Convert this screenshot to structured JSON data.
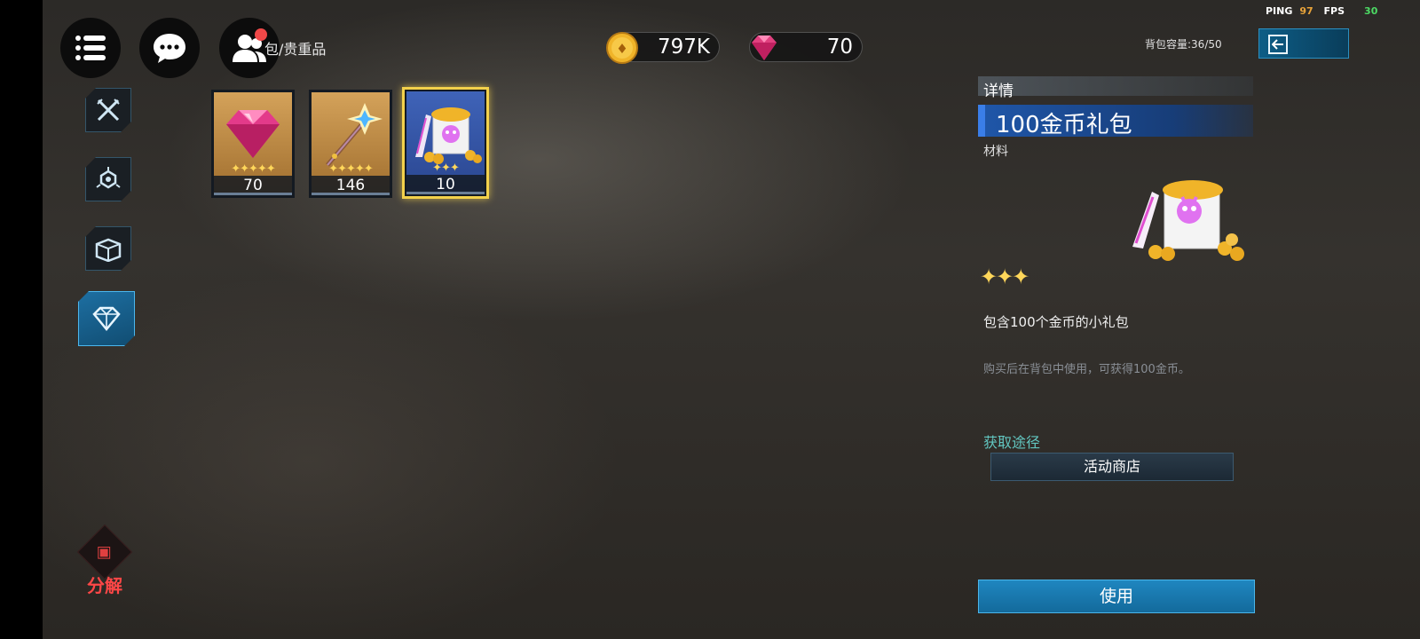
{
  "header": {
    "breadcrumb": "包/贵重品",
    "coins": "797K",
    "gems": "70",
    "capacity_label": "背包容量:36/50"
  },
  "perf": {
    "ping_label": "PING",
    "ping_value": "97",
    "fps_label": "FPS",
    "fps_value": "30"
  },
  "icons": {
    "menu": "menu-icon",
    "chat": "chat-icon",
    "friends": "friends-icon",
    "back": "arrow-left-icon",
    "coin": "coin-icon",
    "gem": "gem-icon",
    "categories": [
      "swords-icon",
      "module-icon",
      "box-icon",
      "diamond-icon"
    ]
  },
  "sidebar": {
    "active_category": 3,
    "decompose_label": "分解"
  },
  "inventory": {
    "items": [
      {
        "name": "gem",
        "stars": "✦✦✦✦✦",
        "count": "70",
        "frame": "gold"
      },
      {
        "name": "staff",
        "stars": "✦✦✦✦✦",
        "count": "146",
        "frame": "gold"
      },
      {
        "name": "coin-pack",
        "stars": "✦✦✦",
        "count": "10",
        "frame": "blue"
      }
    ],
    "selected_index": 2
  },
  "detail": {
    "header": "详情",
    "name": "100金币礼包",
    "type": "材料",
    "stars": "✦✦✦",
    "description": "包含100个金币的小礼包",
    "usage_note": "购买后在背包中使用，可获得100金币。",
    "source_label": "获取途径",
    "source_button": "活动商店",
    "use_button": "使用"
  },
  "colors": {
    "accent_blue": "#1f86c0",
    "star_gold": "#ffd75a",
    "decompose_red": "#ff4747",
    "ping_orange": "#e8a33a",
    "fps_green": "#4cd964",
    "source_teal": "#62c6c0"
  }
}
